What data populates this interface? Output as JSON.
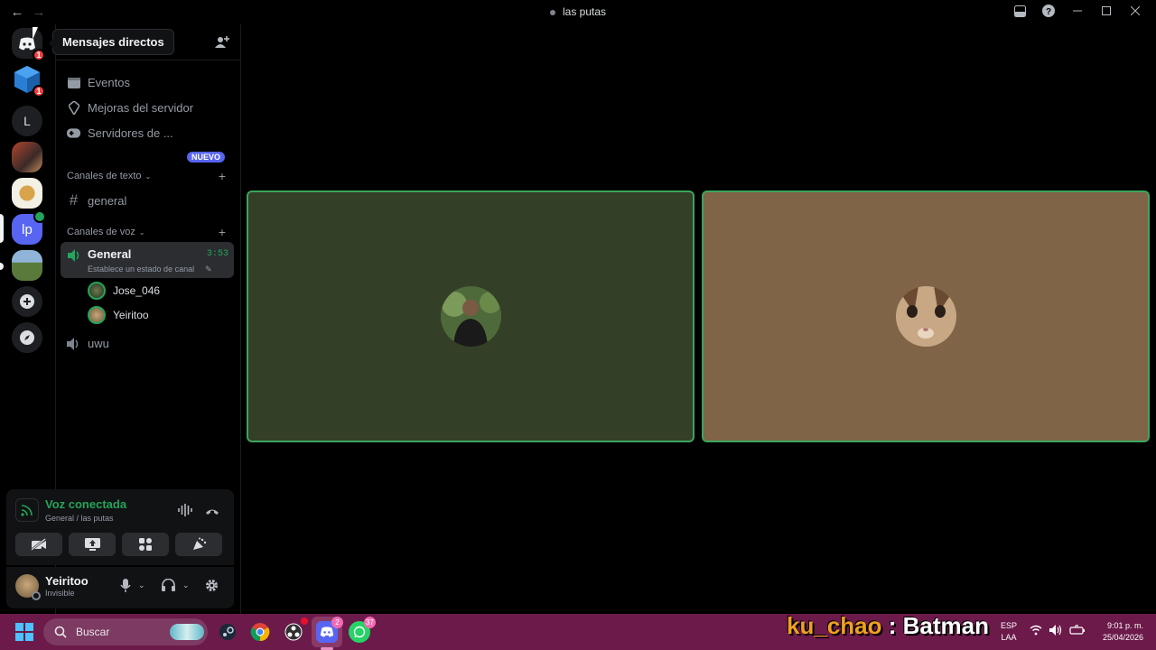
{
  "window": {
    "title": "las putas"
  },
  "tooltip": {
    "text": "Mensajes directos"
  },
  "servers": [
    {
      "name": "direct-messages",
      "badge": "1"
    },
    {
      "name": "server-blue",
      "badge": "1"
    },
    {
      "name": "server-L",
      "initial": "L"
    },
    {
      "name": "server-photo-1"
    },
    {
      "name": "server-burger"
    },
    {
      "name": "server-lp",
      "initial": "lp"
    },
    {
      "name": "server-photo-2"
    }
  ],
  "sidebar": {
    "nav": {
      "events": "Eventos",
      "boosts": "Mejoras del servidor",
      "servers": "Servidores de ...",
      "new_badge": "NUEVO"
    },
    "text_category": "Canales de texto",
    "text_channels": [
      "general"
    ],
    "voice_category": "Canales de voz",
    "voice_active": {
      "name": "General",
      "status": "Establece un estado de canal",
      "time": "3:53",
      "users": [
        "Jose_046",
        "Yeiritoo"
      ]
    },
    "voice_other": "uwu"
  },
  "voice_panel": {
    "title": "Voz conectada",
    "subtitle": "General / las putas"
  },
  "user_panel": {
    "name": "Yeiritoo",
    "status": "Invisible"
  },
  "taskbar": {
    "search": "Buscar",
    "discord_badge": "2",
    "whatsapp_badge": "37",
    "lang_1": "ESP",
    "lang_2": "LAA",
    "time": "9:01 p. m.",
    "date": "25/04/2026"
  },
  "overlay": {
    "user": "ku_chao",
    "sep": ":",
    "message": "Batman"
  },
  "colors": {
    "green": "#23a55a",
    "blurple": "#5865f2",
    "tile_1": "#343f27",
    "tile_2": "#7f6447",
    "taskbar": "#6b1a4a"
  }
}
